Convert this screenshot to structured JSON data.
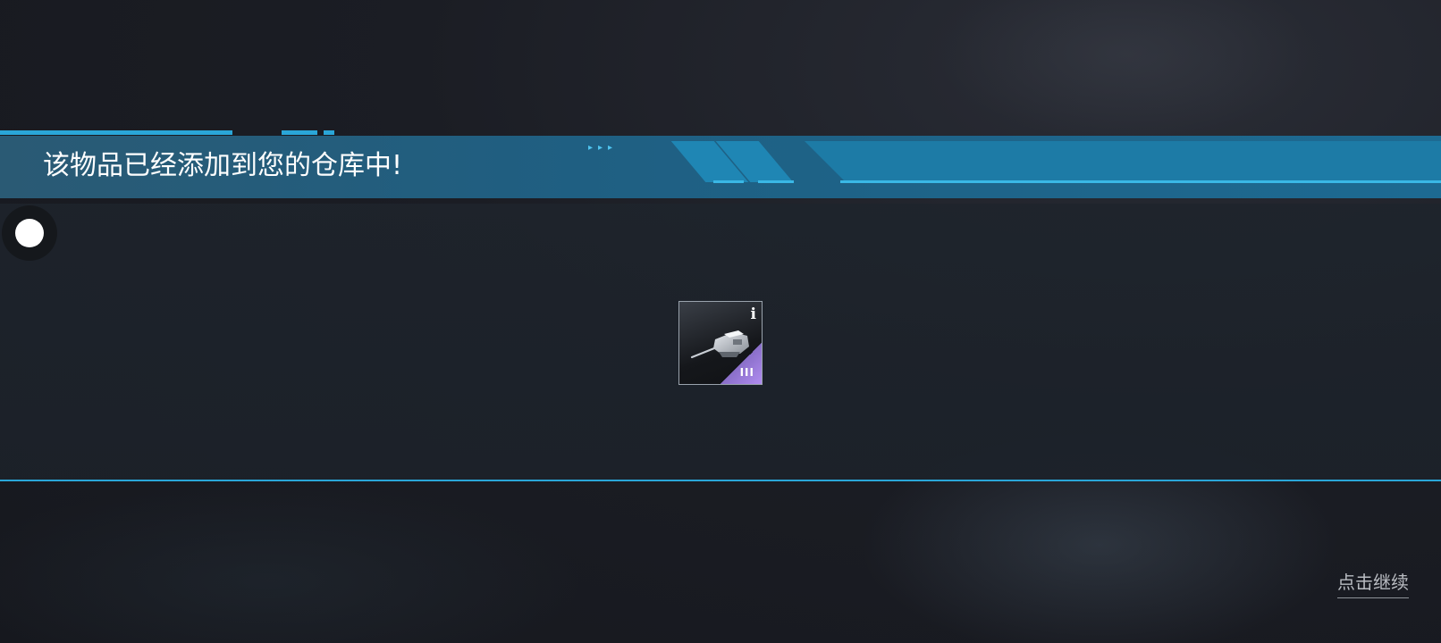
{
  "header": {
    "title": "该物品已经添加到您的仓库中!",
    "chevrons": "▸▸▸"
  },
  "item": {
    "name_icon": "turret-icon",
    "tier": "III",
    "info": "i",
    "rarity_color": "#a884ea"
  },
  "footer": {
    "continue_label": "点击继续"
  },
  "colors": {
    "accent": "#2aa6d8",
    "banner": "#1d6a92"
  }
}
